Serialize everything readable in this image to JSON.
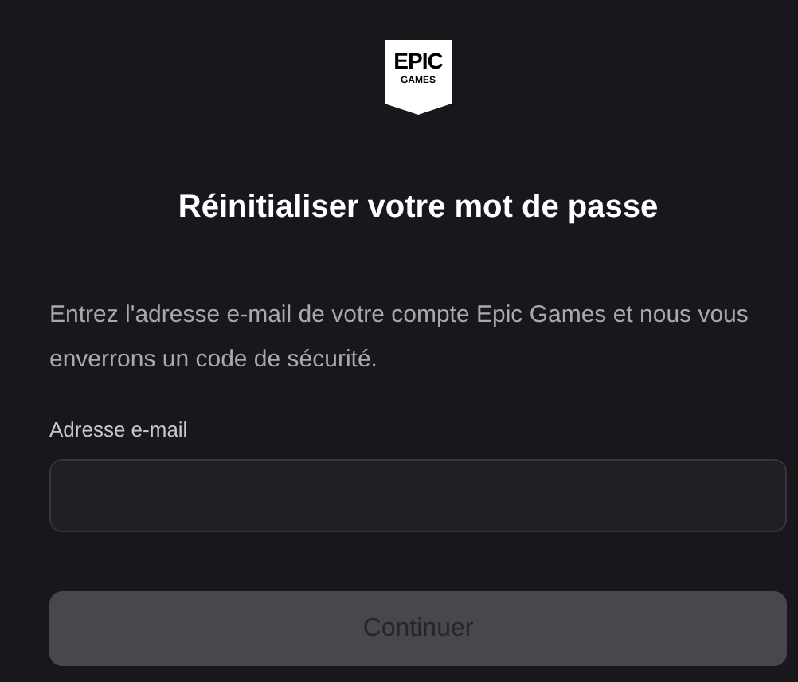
{
  "logo": {
    "top_text": "EPIC",
    "bottom_text": "GAMES"
  },
  "title": "Réinitialiser votre mot de passe",
  "description": "Entrez l'adresse e-mail de votre compte Epic Games et nous vous enverrons un code de sécurité.",
  "email_field": {
    "label": "Adresse e-mail"
  },
  "submit_button": {
    "label": "Continuer",
    "disabled": true
  }
}
